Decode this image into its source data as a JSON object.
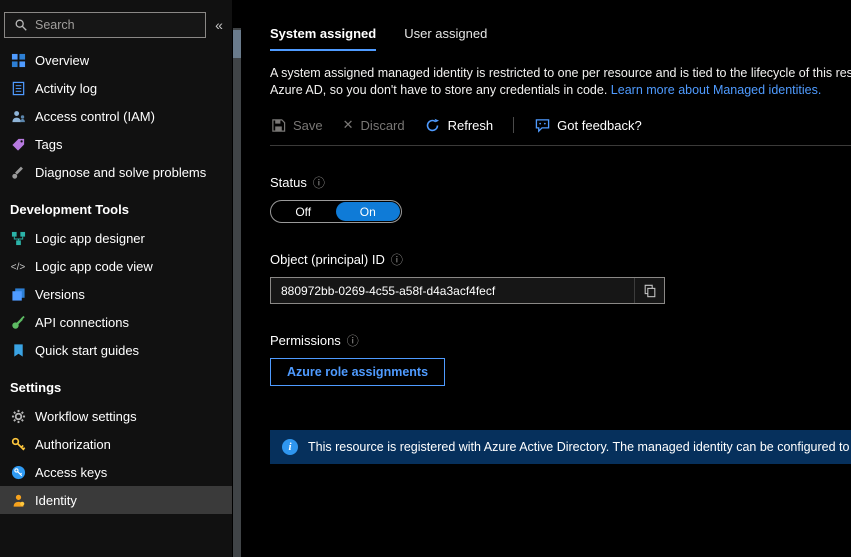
{
  "icons": {
    "collapse": "«",
    "info": "ⓘ",
    "close": "✕",
    "info_letter": "i"
  },
  "colors": {
    "accent_blue": "#4f9bff",
    "toggle_on": "#0f7bd7",
    "banner_bg": "#06305c",
    "selected_item_bg": "#3a3a3a"
  },
  "sidebar": {
    "search_placeholder": "Search",
    "general_items": [
      {
        "label": "Overview",
        "icon": "overview-icon"
      },
      {
        "label": "Activity log",
        "icon": "activity-log-icon"
      },
      {
        "label": "Access control (IAM)",
        "icon": "access-control-icon"
      },
      {
        "label": "Tags",
        "icon": "tag-icon"
      },
      {
        "label": "Diagnose and solve problems",
        "icon": "diagnose-icon"
      }
    ],
    "sections": [
      {
        "header": "Development Tools",
        "items": [
          {
            "label": "Logic app designer",
            "icon": "designer-icon"
          },
          {
            "label": "Logic app code view",
            "icon": "code-view-icon"
          },
          {
            "label": "Versions",
            "icon": "versions-icon"
          },
          {
            "label": "API connections",
            "icon": "api-connections-icon"
          },
          {
            "label": "Quick start guides",
            "icon": "quick-start-icon"
          }
        ]
      },
      {
        "header": "Settings",
        "items": [
          {
            "label": "Workflow settings",
            "icon": "gear-icon"
          },
          {
            "label": "Authorization",
            "icon": "key-icon"
          },
          {
            "label": "Access keys",
            "icon": "access-keys-icon"
          },
          {
            "label": "Identity",
            "icon": "identity-icon",
            "selected": true
          }
        ]
      }
    ]
  },
  "main": {
    "tabs": [
      {
        "label": "System assigned",
        "active": true
      },
      {
        "label": "User assigned",
        "active": false
      }
    ],
    "description": {
      "line1": "A system assigned managed identity is restricted to one per resource and is tied to the lifecycle of this res",
      "line2": "Azure AD, so you don't have to store any credentials in code.",
      "link_text": "Learn more about Managed identities."
    },
    "toolbar": {
      "save": "Save",
      "discard": "Discard",
      "refresh": "Refresh",
      "feedback": "Got feedback?"
    },
    "status": {
      "label": "Status",
      "off": "Off",
      "on": "On",
      "selected": "On"
    },
    "object_id": {
      "label": "Object (principal) ID",
      "value": "880972bb-0269-4c55-a58f-d4a3acf4fecf"
    },
    "permissions": {
      "label": "Permissions",
      "button": "Azure role assignments"
    },
    "banner": {
      "text": "This resource is registered with Azure Active Directory. The managed identity can be configured to allow ac"
    }
  }
}
